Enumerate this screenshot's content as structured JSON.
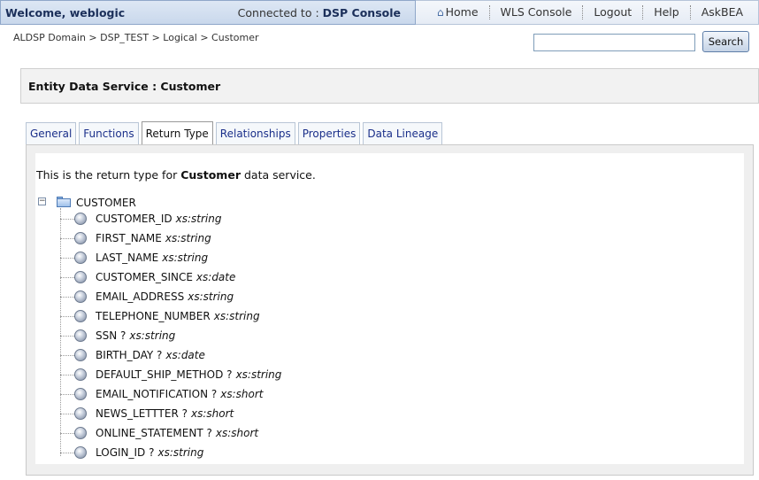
{
  "header": {
    "welcome": "Welcome, weblogic",
    "connected_prefix": "Connected to :",
    "connected_target": "DSP Console",
    "nav": [
      "Home",
      "WLS Console",
      "Logout",
      "Help",
      "AskBEA"
    ]
  },
  "breadcrumb": "ALDSP Domain > DSP_TEST > Logical > Customer",
  "search": {
    "value": "",
    "button": "Search"
  },
  "page_title": "Entity Data Service : Customer",
  "tabs": [
    "General",
    "Functions",
    "Return Type",
    "Relationships",
    "Properties",
    "Data Lineage"
  ],
  "active_tab": "Return Type",
  "content": {
    "intro_prefix": "This is the return type for",
    "intro_entity": "Customer",
    "intro_suffix": "data service.",
    "root": {
      "name": "CUSTOMER",
      "toggle": "−",
      "icon": "folder-icon"
    },
    "fields": [
      {
        "name": "CUSTOMER_ID",
        "type": "xs:string"
      },
      {
        "name": "FIRST_NAME",
        "type": "xs:string"
      },
      {
        "name": "LAST_NAME",
        "type": "xs:string"
      },
      {
        "name": "CUSTOMER_SINCE",
        "type": "xs:date"
      },
      {
        "name": "EMAIL_ADDRESS",
        "type": "xs:string"
      },
      {
        "name": "TELEPHONE_NUMBER",
        "type": "xs:string"
      },
      {
        "name": "SSN ?",
        "type": "xs:string"
      },
      {
        "name": "BIRTH_DAY ?",
        "type": "xs:date"
      },
      {
        "name": "DEFAULT_SHIP_METHOD ?",
        "type": "xs:string"
      },
      {
        "name": "EMAIL_NOTIFICATION ?",
        "type": "xs:short"
      },
      {
        "name": "NEWS_LETTTER ?",
        "type": "xs:short"
      },
      {
        "name": "ONLINE_STATEMENT ?",
        "type": "xs:short"
      },
      {
        "name": "LOGIN_ID ?",
        "type": "xs:string"
      }
    ]
  }
}
